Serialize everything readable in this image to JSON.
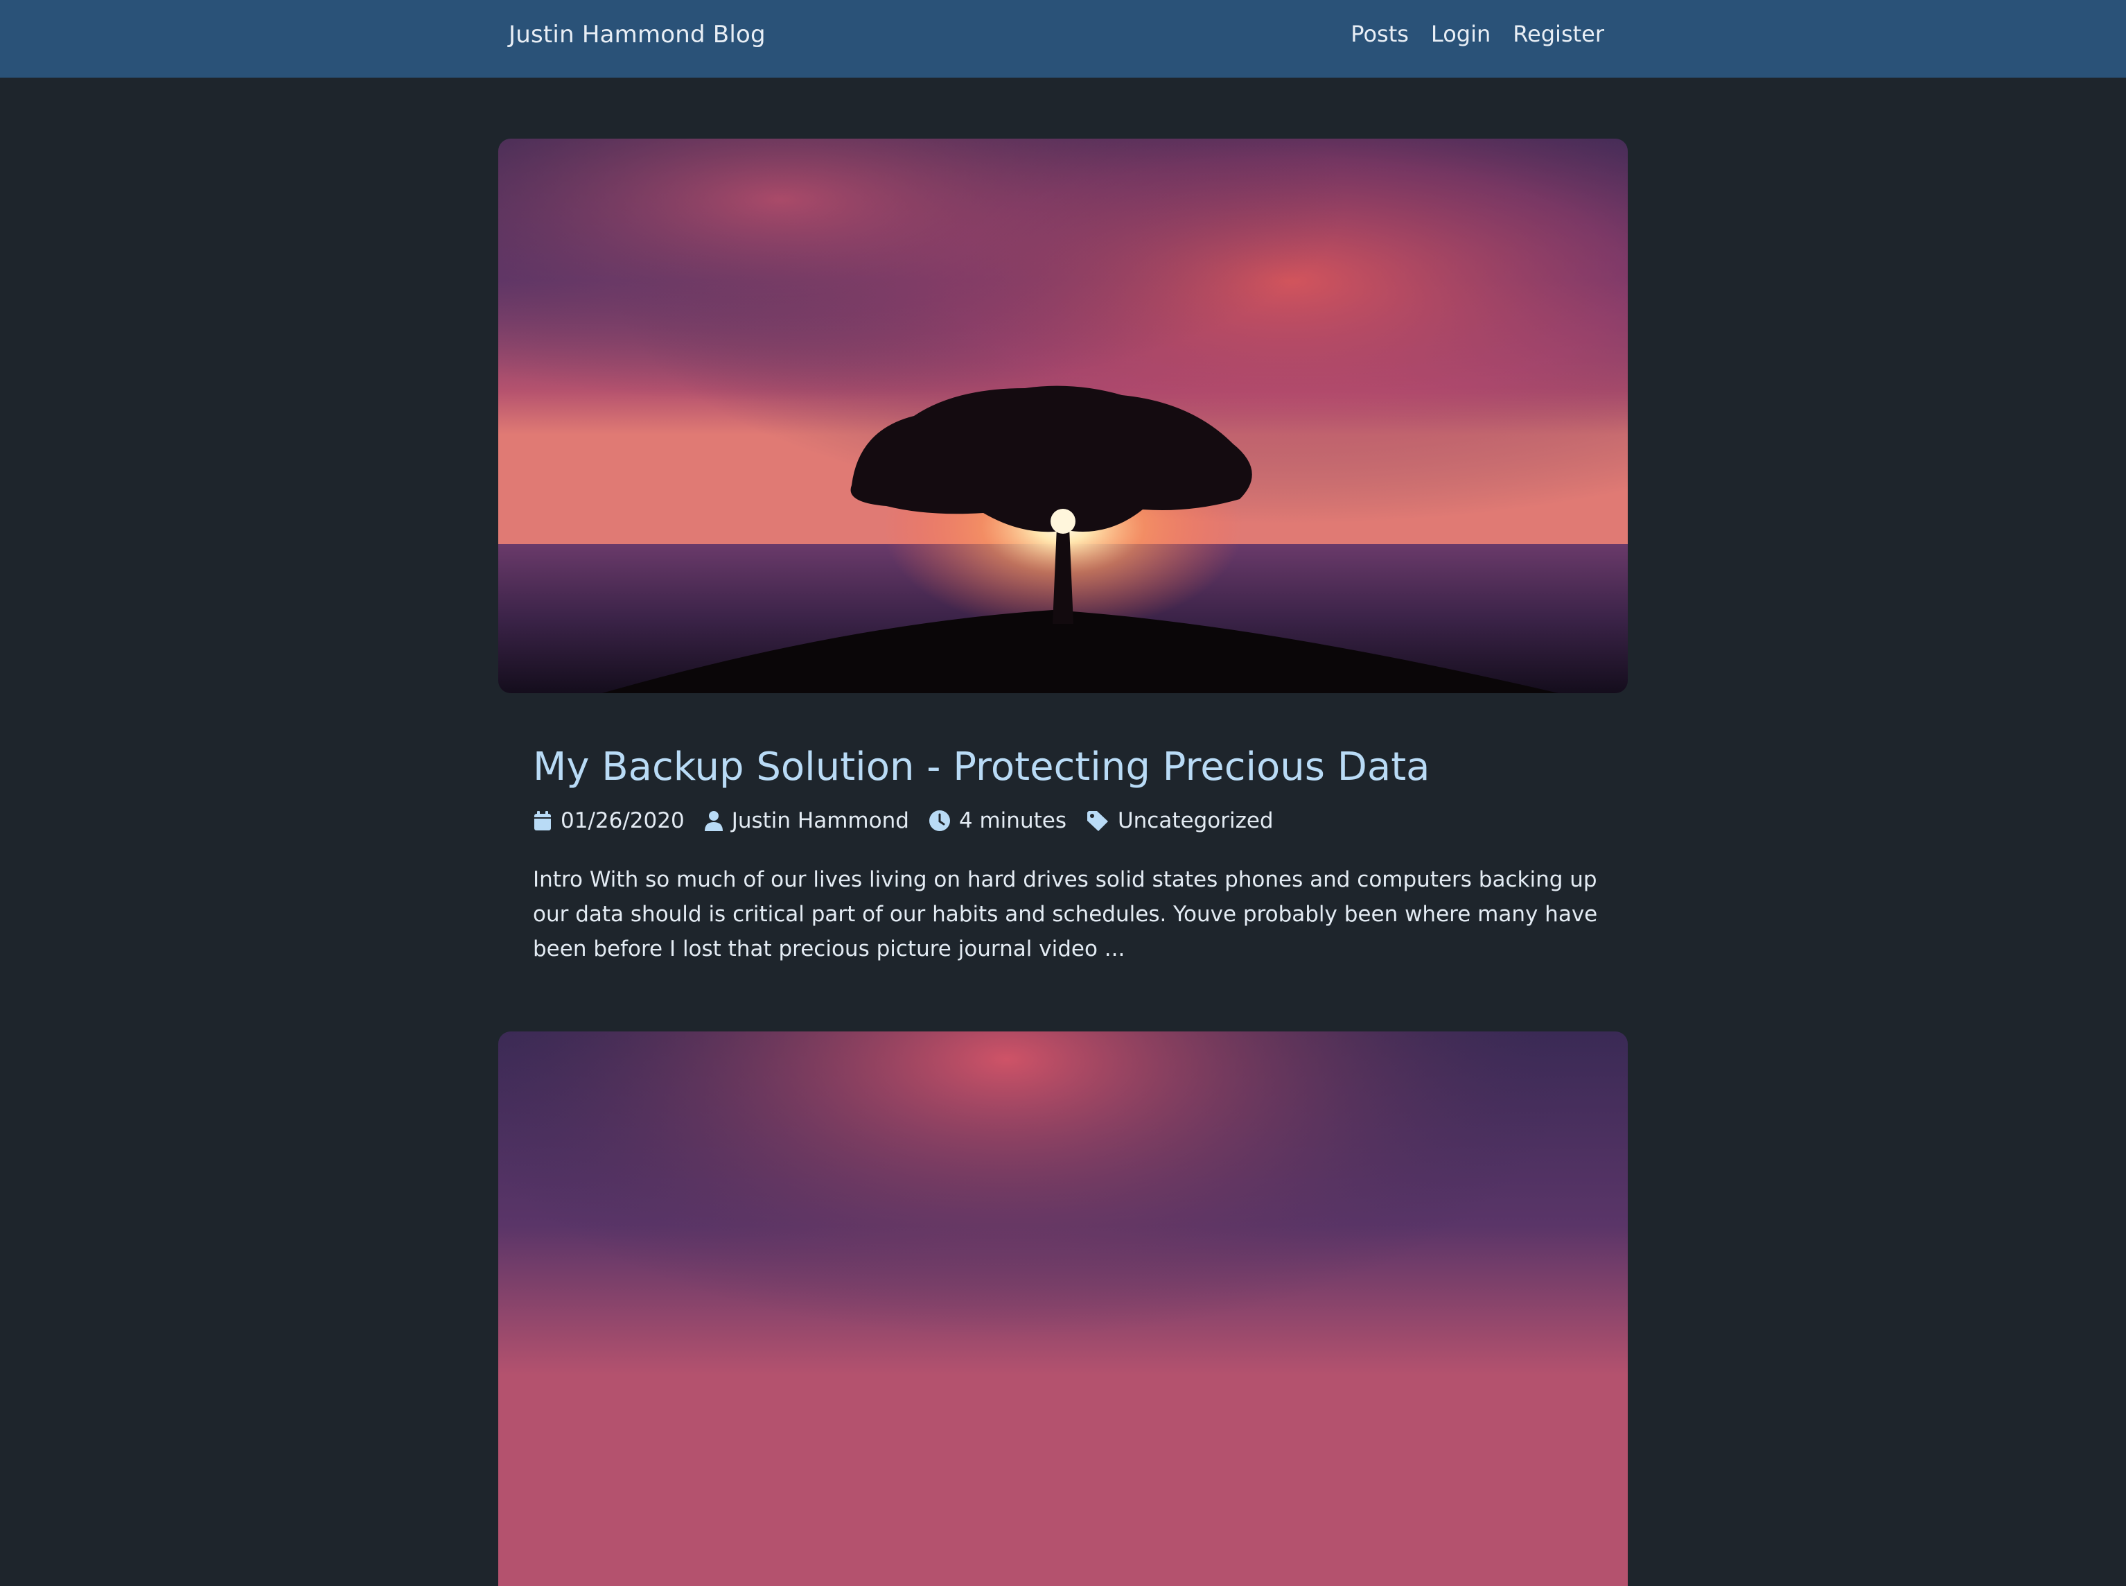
{
  "brand": "Justin Hammond Blog",
  "nav": {
    "posts": "Posts",
    "login": "Login",
    "register": "Register"
  },
  "colors": {
    "navbar": "#2a5278",
    "background": "#1e252c",
    "title": "#b9dbf6",
    "text": "#e3ebf3"
  },
  "posts": [
    {
      "image": "sunset-tree-over-sea",
      "title": "My Backup Solution - Protecting Precious Data",
      "date": "01/26/2020",
      "author": "Justin Hammond",
      "read_time": "4 minutes",
      "category": "Uncategorized",
      "excerpt": "Intro With so much of our lives living on hard drives solid states phones and computers backing up our data should is critical part of our habits and schedules. Youve probably been where many have been before I lost that precious picture journal video ..."
    },
    {
      "image": "sunset-tree-over-sea"
    }
  ],
  "icons": {
    "date": "calendar-icon",
    "author": "user-icon",
    "read_time": "clock-icon",
    "category": "tag-icon"
  }
}
